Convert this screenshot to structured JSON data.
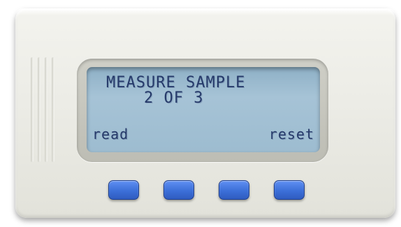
{
  "display": {
    "line1": "MEASURE SAMPLE",
    "line2": "2 OF  3",
    "softkey_left": "read",
    "softkey_right": "reset"
  },
  "buttons": [
    {
      "name": "button-1"
    },
    {
      "name": "button-2"
    },
    {
      "name": "button-3"
    },
    {
      "name": "button-4"
    }
  ],
  "colors": {
    "device_body": "#ecece6",
    "lcd_background": "#a6c3d6",
    "lcd_text": "#263a6a",
    "button_blue": "#3c6fd8"
  }
}
